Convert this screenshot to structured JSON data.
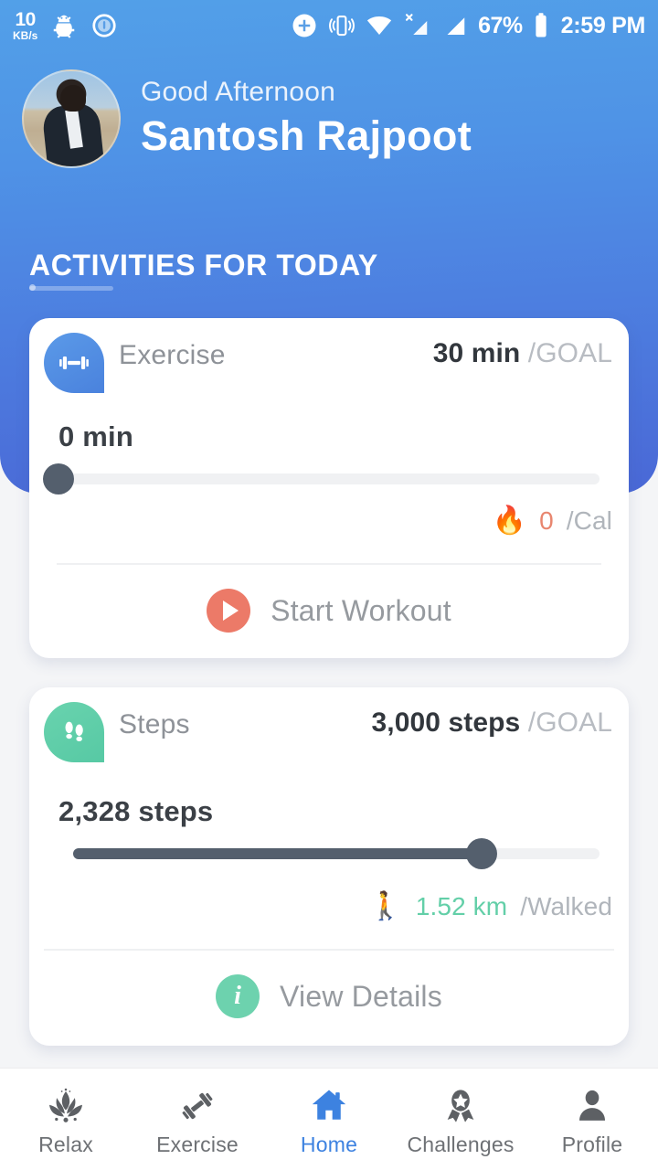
{
  "status_bar": {
    "net_speed_value": "10",
    "net_speed_unit": "KB/s",
    "battery_percent": "67%",
    "time": "2:59 PM",
    "icons": [
      "net-speed-icon",
      "bug-icon",
      "circle-dot-icon",
      "plus-circle-icon",
      "vibrate-icon",
      "wifi-icon",
      "sim1-no-signal-icon",
      "sim2-signal-icon",
      "battery-icon"
    ]
  },
  "header": {
    "greeting": "Good Afternoon",
    "user_name": "Santosh Rajpoot",
    "avatar_alt": "user-avatar",
    "section_title": "ACTIVITIES FOR TODAY"
  },
  "cards": [
    {
      "id": "exercise",
      "icon": "dumbbell-icon",
      "accent": "#4a82dd",
      "label": "Exercise",
      "goal_value": "30 min",
      "goal_suffix": "/GOAL",
      "progress_text": "0 min",
      "progress_percent": 0,
      "metric_emoji": "🔥",
      "metric_icon": "flame-icon",
      "metric_value": "0",
      "metric_suffix": "/Cal",
      "metric_color": "#e8866f",
      "action_label": "Start Workout",
      "action_icon": "play-icon",
      "action_color": "#ec7a68"
    },
    {
      "id": "steps",
      "icon": "footprints-icon",
      "accent": "#57c9a4",
      "label": "Steps",
      "goal_value": "3,000 steps",
      "goal_suffix": "/GOAL",
      "progress_text": "2,328 steps",
      "progress_percent": 77.6,
      "metric_emoji": "🚶",
      "metric_icon": "walking-person-icon",
      "metric_value": "1.52 km",
      "metric_suffix": "/Walked",
      "metric_color": "#63cfa8",
      "action_label": "View Details",
      "action_icon": "info-icon",
      "action_color": "#6dd2ae"
    }
  ],
  "bottom_nav": {
    "active": "Home",
    "active_color": "#3d82e0",
    "items": [
      {
        "label": "Relax",
        "icon": "lotus-icon"
      },
      {
        "label": "Exercise",
        "icon": "dumbbell-icon"
      },
      {
        "label": "Home",
        "icon": "home-icon"
      },
      {
        "label": "Challenges",
        "icon": "award-ribbon-icon"
      },
      {
        "label": "Profile",
        "icon": "person-icon"
      }
    ]
  }
}
